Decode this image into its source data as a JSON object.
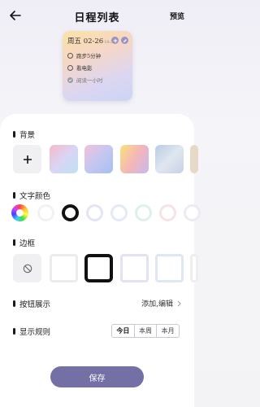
{
  "header": {
    "title": "日程列表",
    "preview_label": "预览"
  },
  "widget": {
    "date": "周五 02-26",
    "date_suffix": "10:32",
    "items": [
      {
        "text": "跑步5分钟",
        "done": false
      },
      {
        "text": "看电影",
        "done": false
      },
      {
        "text": "阅读一小时",
        "done": true
      }
    ]
  },
  "sections": {
    "background": "背景",
    "text_color": "文字颜色",
    "border": "边框",
    "button_display": "按钮展示",
    "display_rule": "显示规则"
  },
  "button_display_value": "添加,编辑",
  "display_rule_options": [
    "今日",
    "本周",
    "本月"
  ],
  "display_rule_selected": "今日",
  "save_label": "保存",
  "colors": {
    "accent": "#7470a6",
    "text_color_selected": "#111111"
  }
}
